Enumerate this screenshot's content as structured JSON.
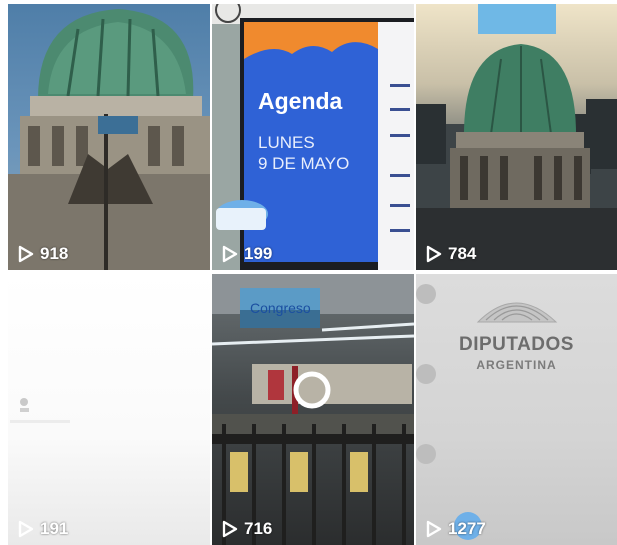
{
  "tiles": [
    {
      "views": "918"
    },
    {
      "views": "199",
      "agenda_title": "Agenda",
      "agenda_day": "LUNES",
      "agenda_date": "9 DE MAYO"
    },
    {
      "views": "784"
    },
    {
      "views": "191"
    },
    {
      "views": "716",
      "station_sign": "Congreso"
    },
    {
      "views": "1277",
      "wall_title": "DIPUTADOS",
      "wall_subtitle": "ARGENTINA"
    }
  ],
  "colors": {
    "agenda_blue": "#2f62d6",
    "agenda_orange": "#f08a2e",
    "dome_green": "#3f7e63"
  }
}
